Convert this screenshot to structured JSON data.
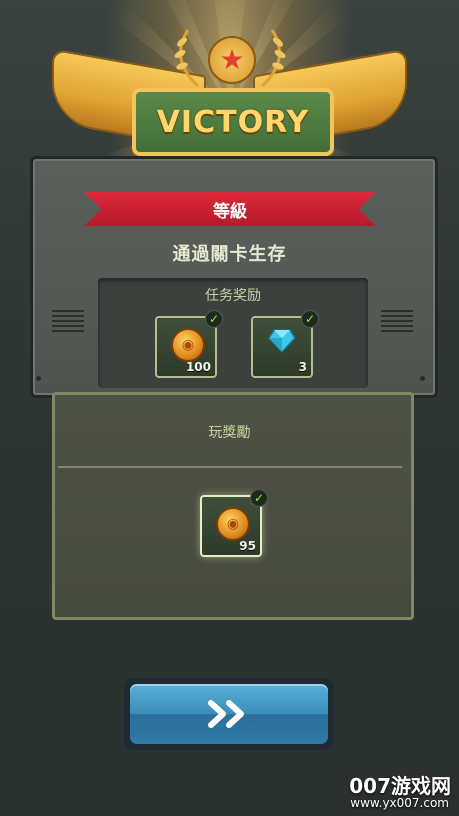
{
  "banner": {
    "title": "VICTORY"
  },
  "rank": {
    "label": "等級"
  },
  "subtitle": "通過關卡生存",
  "task_rewards": {
    "title": "任务奖励",
    "items": [
      {
        "icon": "coin-icon",
        "count": "100",
        "claimed": true
      },
      {
        "icon": "diamond-icon",
        "count": "3",
        "claimed": true
      }
    ]
  },
  "play_rewards": {
    "title": "玩獎勵",
    "items": [
      {
        "icon": "coin-icon",
        "count": "95",
        "claimed": true
      }
    ]
  },
  "next_button": {
    "icon": "double-chevron-right-icon"
  },
  "watermark": {
    "brand": "007游戏网",
    "url": "www.yx007.com"
  },
  "colors": {
    "gold": "#ffd76a",
    "ribbon_red": "#d2223a",
    "button_blue": "#3a8cb9",
    "check_green": "#9ee64a"
  }
}
